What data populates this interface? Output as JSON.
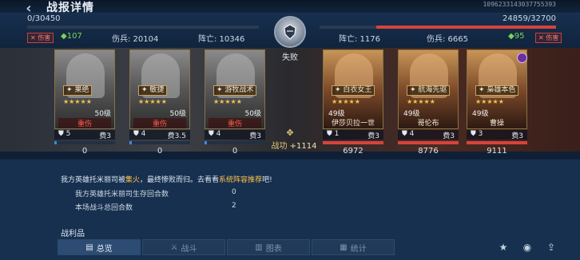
{
  "header": {
    "title": "战报详情",
    "report_id": "1096233143037755393"
  },
  "left": {
    "hp_text": "0/30450",
    "hp_fraction": 0.0,
    "tag": "伤害",
    "morale": "107",
    "kills_label": "伤兵: 20104",
    "dead_label": "阵亡: 10346"
  },
  "right": {
    "hp_text": "24859/32700",
    "hp_fraction": 0.76,
    "tag": "伤害",
    "morale": "95",
    "kills_label": "伤兵: 6665",
    "dead_label": "阵亡: 1176"
  },
  "result": "失败",
  "war_power": {
    "label": "战功",
    "value": "+1114"
  },
  "our_heroes": [
    {
      "skill": "果绝",
      "level": "50级",
      "status": "重伤",
      "troops": "5",
      "cost": "费3",
      "remaining": "0"
    },
    {
      "skill": "敏捷",
      "level": "50级",
      "status": "重伤",
      "troops": "4",
      "cost": "费3.5",
      "remaining": "0"
    },
    {
      "skill": "游牧战术",
      "level": "50级",
      "status": "重伤",
      "troops": "4",
      "cost": "费3",
      "remaining": "0"
    }
  ],
  "enemy_heroes": [
    {
      "skill": "白衣女王",
      "level": "49级",
      "name": "伊莎贝拉一世",
      "troops": "1",
      "cost": "费3",
      "remaining": "6972"
    },
    {
      "skill": "航海先驱",
      "level": "49级",
      "name": "哥伦布",
      "troops": "4",
      "cost": "费3",
      "remaining": "8776"
    },
    {
      "skill": "枭雄本色",
      "level": "49级",
      "name": "曹操",
      "troops": "3",
      "cost": "费3",
      "remaining": "9111"
    }
  ],
  "log": {
    "line_prefix": "我方英雄托米丽司被",
    "line_hl1": "集火",
    "line_mid": "，最终惨败而归。去看看",
    "line_hl2": "系统阵容推荐",
    "line_suffix": "吧!",
    "rows": [
      {
        "label": "我方英雄托米丽司生存回合数",
        "value": "0"
      },
      {
        "label": "本场战斗总回合数",
        "value": "2"
      }
    ],
    "spoils": "战利品"
  },
  "tabs": [
    {
      "label": "总览",
      "icon": "document-icon"
    },
    {
      "label": "战斗",
      "icon": "crossed-swords-icon"
    },
    {
      "label": "图表",
      "icon": "chart-icon"
    },
    {
      "label": "统计",
      "icon": "stats-icon"
    }
  ],
  "colors": {
    "ally_bar": "#3a8ce0",
    "enemy_bar": "#d6433c",
    "highlight": "#ffc247"
  }
}
